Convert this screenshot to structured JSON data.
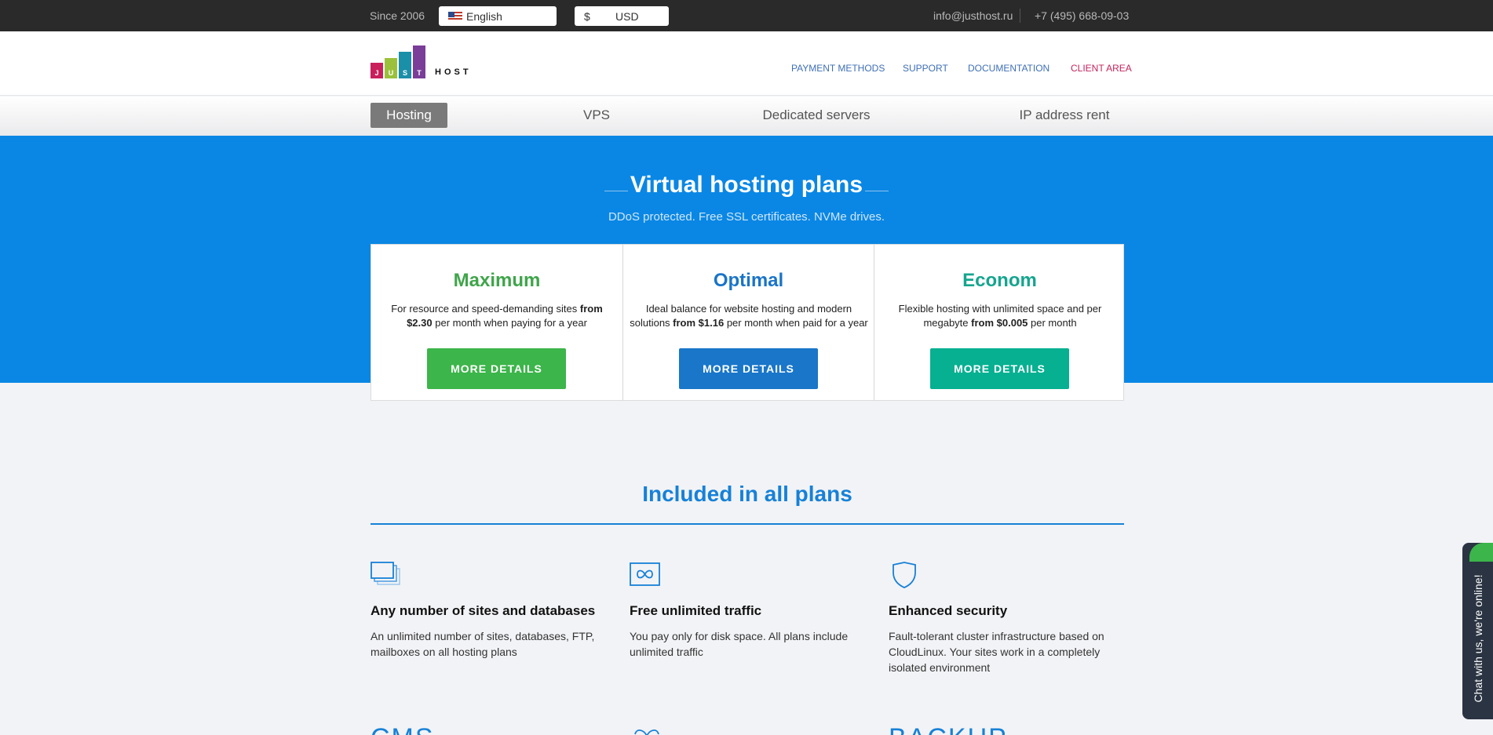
{
  "topbar": {
    "since": "Since 2006",
    "language": "English",
    "currency_symbol": "$",
    "currency": "USD",
    "email": "info@justhost.ru",
    "phone": "+7 (495) 668-09-03"
  },
  "logo": {
    "letters": [
      "J",
      "U",
      "S",
      "T"
    ],
    "host": "HOST"
  },
  "nav": {
    "payment_methods": "PAYMENT METHODS",
    "support": "SUPPORT",
    "documentation": "DOCUMENTATION",
    "client_area": "CLIENT AREA"
  },
  "tabs": [
    "Hosting",
    "VPS",
    "Dedicated servers",
    "IP address rent"
  ],
  "hero": {
    "title": "Virtual hosting plans",
    "subtitle": "DDoS protected. Free SSL certificates. NVMe drives."
  },
  "plans": [
    {
      "name": "Maximum",
      "desc_before": "For resource and speed-demanding sites ",
      "price": "from $2.30",
      "desc_after": " per month when paying for a year",
      "button": "MORE DETAILS"
    },
    {
      "name": "Optimal",
      "desc_before": "Ideal balance for website hosting and modern solutions ",
      "price": "from $1.16",
      "desc_after": " per month when paid for a year",
      "button": "MORE DETAILS"
    },
    {
      "name": "Econom",
      "desc_before": "Flexible hosting with unlimited space and per megabyte ",
      "price": "from $0.005",
      "desc_after": " per month",
      "button": "MORE DETAILS"
    }
  ],
  "included": {
    "title": "Included in all plans",
    "features": [
      {
        "icon": "windows-stack-icon",
        "title": "Any number of sites and databases",
        "text": "An unlimited number of sites, databases, FTP, mailboxes on all hosting plans"
      },
      {
        "icon": "infinity-icon",
        "title": "Free unlimited traffic",
        "text": "You pay only for disk space. All plans include unlimited traffic"
      },
      {
        "icon": "shield-icon",
        "title": "Enhanced security",
        "text": "Fault-tolerant cluster infrastructure based on CloudLinux. Your sites work in a completely isolated environment"
      }
    ],
    "next_row": [
      "CMS",
      "BACKUP"
    ]
  },
  "chat": {
    "label": "Chat with us, we're online!"
  },
  "colors": {
    "maximum": "#3fa54a",
    "optimal": "#1a74c8",
    "econom": "#15a58e",
    "btn_maximum": "#3cb54a",
    "btn_optimal": "#1976c9",
    "btn_econom": "#06b091",
    "hero_bg": "#0a87e4",
    "client_area": "#c2245c"
  }
}
